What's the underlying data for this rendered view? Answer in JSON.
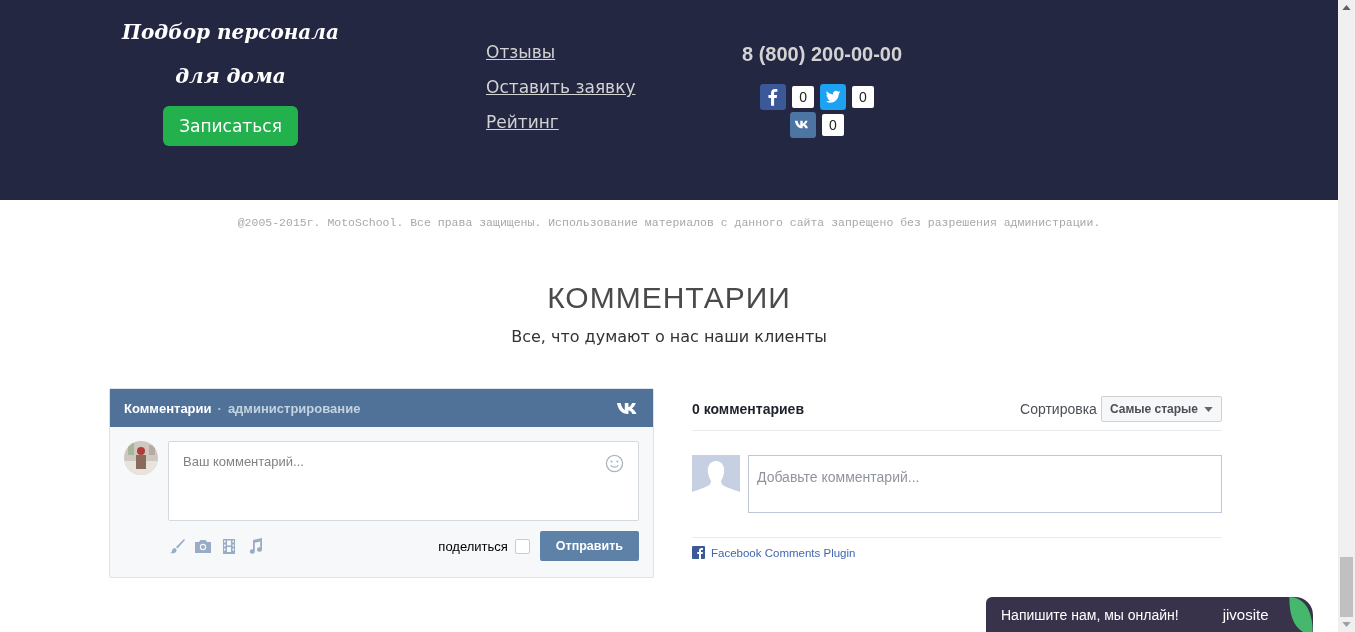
{
  "footer": {
    "title_lines": [
      "Подбор персонала",
      "для дома"
    ],
    "signup_button": "Записаться",
    "links": [
      "Отзывы",
      "Оставить заявку",
      "Рейтинг"
    ],
    "phone": "8 (800) 200-00-00",
    "share": [
      {
        "kind": "facebook",
        "count": "0"
      },
      {
        "kind": "twitter",
        "count": "0"
      },
      {
        "kind": "vk",
        "count": "0"
      }
    ]
  },
  "copyright": "@2005-2015г. MotoSchool. Все права защищены. Использование материалов с данного сайта запрещено без разрешения администрации.",
  "comments": {
    "heading": "КОММЕНТАРИИ",
    "subtitle": "Все, что думают о нас наши клиенты",
    "vk_widget": {
      "title": "Комментарии",
      "separator": "·",
      "admin_link": "администрирование",
      "placeholder": "Ваш комментарий...",
      "share_label": "поделиться",
      "share_checked": false,
      "send_button": "Отправить"
    },
    "fb_widget": {
      "count_label": "0 комментариев",
      "sort_label": "Сортировка",
      "sort_value": "Самые старые",
      "placeholder": "Добавьте комментарий...",
      "plugin_link": "Facebook Comments Plugin"
    }
  },
  "chat": {
    "text": "Напишите нам, мы онлайн!",
    "brand": "jivosite"
  }
}
